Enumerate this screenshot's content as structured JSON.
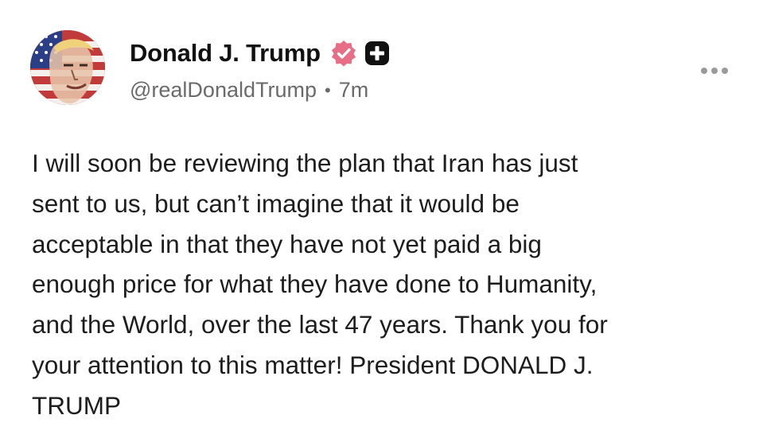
{
  "post": {
    "author": {
      "display_name": "Donald J. Trump",
      "handle": "@realDonaldTrump",
      "separator": "•",
      "timestamp": "7m",
      "verified_icon": "verified-badge-icon",
      "extra_icon": "plus-badge-icon",
      "avatar_icon": "profile-avatar"
    },
    "more_icon": "more-options-icon",
    "text": "I will soon be reviewing the plan that Iran has just\nsent to us, but can’t imagine that it would be\nacceptable in that they have not yet paid a big\nenough price for what they have done to Humanity,\nand the World, over the last 47 years. Thank you for\nyour attention to this matter! President DONALD J.\nTRUMP"
  },
  "colors": {
    "verified_badge": "#e66f86",
    "plus_badge": "#111111",
    "handle_text": "#6a6a6a",
    "body_text": "#1d1d1d"
  }
}
